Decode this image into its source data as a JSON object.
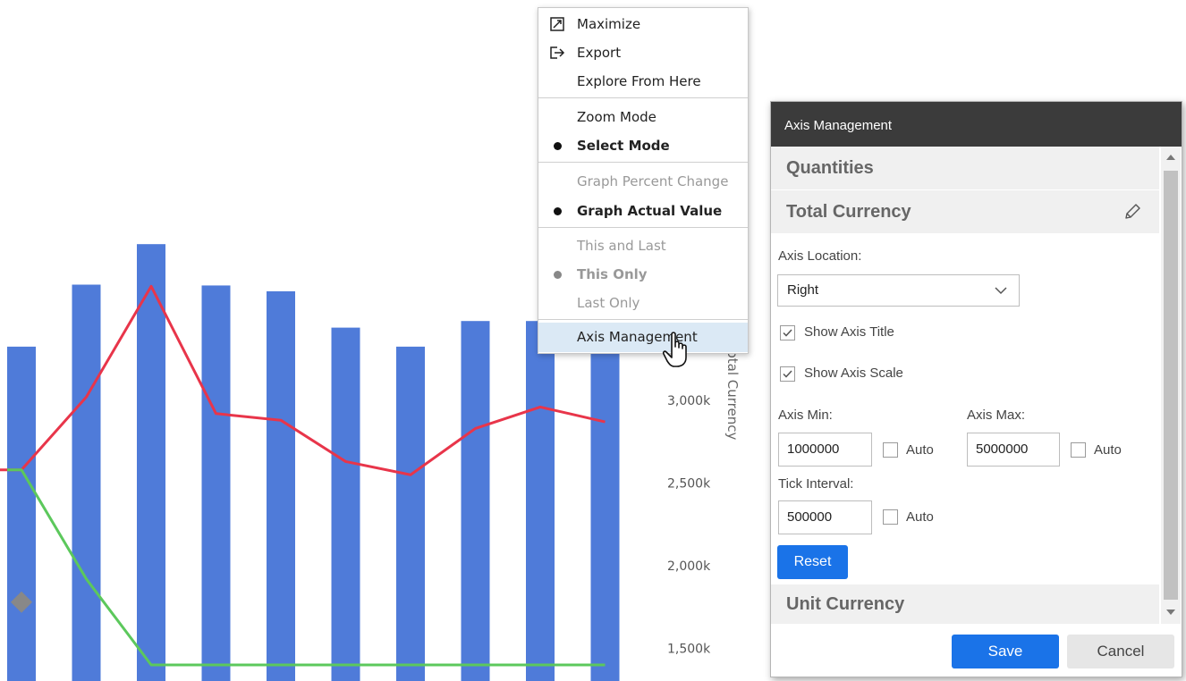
{
  "context_menu": {
    "items": [
      {
        "label": "Maximize",
        "icon": "maximize-icon"
      },
      {
        "label": "Export",
        "icon": "export-icon"
      },
      {
        "label": "Explore From Here"
      },
      {
        "label": "Zoom Mode"
      },
      {
        "label": "Select Mode",
        "selected": true
      },
      {
        "label": "Graph Percent Change",
        "disabled": true
      },
      {
        "label": "Graph Actual Value",
        "selected": true
      },
      {
        "label": "This and Last",
        "disabled": true
      },
      {
        "label": "This Only",
        "selected": true,
        "disabled": true
      },
      {
        "label": "Last Only",
        "disabled": true
      },
      {
        "label": "Axis Management",
        "hovered": true
      }
    ]
  },
  "axis_dialog": {
    "title": "Axis Management",
    "sections": {
      "quantities": "Quantities",
      "total_currency": "Total Currency",
      "unit_currency": "Unit Currency"
    },
    "axis_location_label": "Axis Location:",
    "axis_location_value": "Right",
    "show_axis_title": {
      "label": "Show Axis Title",
      "checked": true
    },
    "show_axis_scale": {
      "label": "Show Axis Scale",
      "checked": true
    },
    "axis_min_label": "Axis Min:",
    "axis_min_value": "1000000",
    "axis_max_label": "Axis Max:",
    "axis_max_value": "5000000",
    "tick_interval_label": "Tick Interval:",
    "tick_interval_value": "500000",
    "auto_label": "Auto",
    "reset_label": "Reset",
    "save_label": "Save",
    "cancel_label": "Cancel"
  },
  "colors": {
    "bar": "#4f7bd9",
    "red_line": "#e8354a",
    "green_line": "#5cc85c",
    "diamond": "#888888",
    "accent": "#1a73e8",
    "dialog_header": "#3b3b3b"
  },
  "chart_data": {
    "type": "bar",
    "title": "",
    "ylabel": "Total Currency",
    "yaxis_side": "right",
    "y_ticks": [
      "3,000k",
      "2,500k",
      "2,000k",
      "1,500k"
    ],
    "ylim": [
      1400,
      3900
    ],
    "bar_values": [
      3325,
      3700,
      3945,
      3695,
      3660,
      3440,
      3325,
      3480,
      3480,
      3450
    ],
    "series": [
      {
        "values": [
          2580,
          3020,
          3690,
          2920,
          2880,
          2630,
          2550,
          2830,
          2960,
          2870
        ]
      },
      {
        "values": [
          2580,
          1920,
          1400,
          1400,
          1400,
          1400,
          1400,
          1400,
          1400,
          1400
        ]
      }
    ],
    "marker": {
      "index": 0,
      "value": 1780
    }
  }
}
